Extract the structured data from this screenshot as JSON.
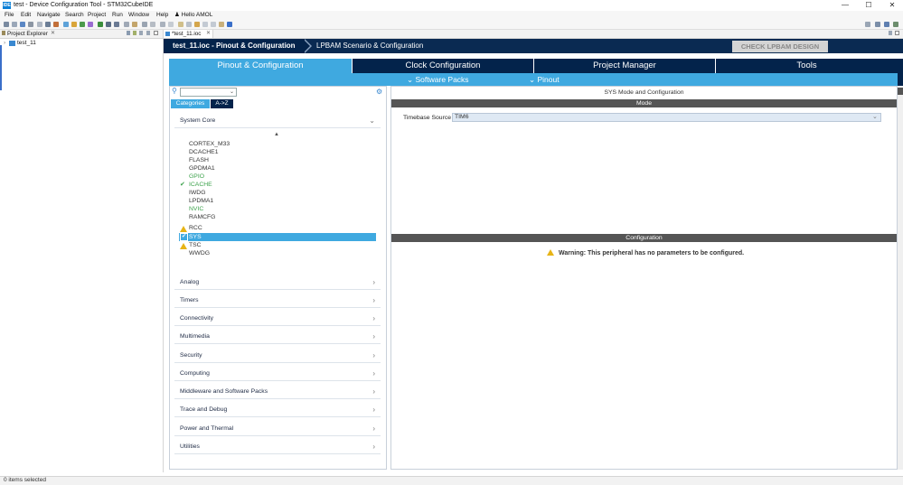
{
  "window": {
    "title": "test - Device Configuration Tool - STM32CubeIDE",
    "app_icon": "IDE",
    "minimize": "—",
    "maximize": "☐",
    "close": "✕"
  },
  "menu": [
    "File",
    "Edit",
    "Navigate",
    "Search",
    "Project",
    "Run",
    "Window",
    "Help"
  ],
  "user": "Hello AMOL",
  "explorer": {
    "tab": "Project Explorer",
    "tree_item": "test_11"
  },
  "editor_tab": "*test_11.ioc",
  "breadcrumb": {
    "current": "test_11.ioc - Pinout & Configuration",
    "next": "LPBAM Scenario & Configuration",
    "check_button": "CHECK LPBAM DESIGN"
  },
  "main_tabs": [
    "Pinout & Configuration",
    "Clock Configuration",
    "Project Manager",
    "Tools"
  ],
  "sub_buttons": {
    "software_packs": "Software Packs",
    "pinout": "Pinout"
  },
  "left": {
    "tabs": {
      "categories": "Categories",
      "az": "A->Z"
    },
    "system_core": "System Core",
    "peripherals": [
      "CORTEX_M33",
      "DCACHE1",
      "FLASH",
      "GPDMA1",
      "GPIO",
      "ICACHE",
      "IWDG",
      "LPDMA1",
      "NVIC",
      "RAMCFG",
      "RCC",
      "SYS",
      "TSC",
      "WWDG"
    ],
    "categories": [
      "Analog",
      "Timers",
      "Connectivity",
      "Multimedia",
      "Security",
      "Computing",
      "Middleware and Software Packs",
      "Trace and Debug",
      "Power and Thermal",
      "Utilities"
    ]
  },
  "right": {
    "title": "SYS Mode and Configuration",
    "mode_header": "Mode",
    "timebase_label": "Timebase Source",
    "timebase_value": "TIM6",
    "config_header": "Configuration",
    "warning": "Warning: This peripheral has no parameters to be configured."
  },
  "status": "0 items selected",
  "colors": {
    "navy": "#03234b",
    "accent": "#3fa9e0",
    "green": "#3ca24b",
    "warning": "#e7b416"
  }
}
